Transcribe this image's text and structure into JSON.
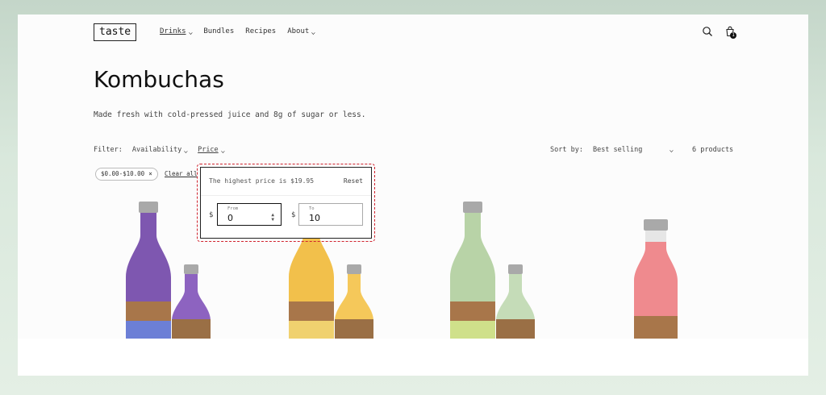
{
  "header": {
    "logo": "taste",
    "nav": [
      {
        "label": "Drinks",
        "has_chevron": true,
        "active": true
      },
      {
        "label": "Bundles",
        "has_chevron": false,
        "active": false
      },
      {
        "label": "Recipes",
        "has_chevron": false,
        "active": false
      },
      {
        "label": "About",
        "has_chevron": true,
        "active": false
      }
    ],
    "icons": [
      "search-icon",
      "cart-icon"
    ],
    "cart_count": "1"
  },
  "collection": {
    "title": "Kombuchas",
    "description": "Made fresh with cold-pressed juice and 8g of sugar or less."
  },
  "filters": {
    "label": "Filter:",
    "availability": "Availability",
    "price": "Price",
    "sort_label": "Sort by:",
    "sort_value": "Best selling",
    "product_count": "6 products",
    "active_chip": "$0.00-$10.00",
    "chip_remove": "×",
    "clear_all": "Clear all"
  },
  "price_popup": {
    "note": "The highest price is $19.95",
    "reset": "Reset",
    "currency": "$",
    "from_label": "From",
    "from_value": "0",
    "to_label": "To",
    "to_value": "10"
  },
  "products": [
    {
      "color": "#7e57b0",
      "name": "purple-kombucha"
    },
    {
      "color": "#f2c04b",
      "name": "yellow-kombucha"
    },
    {
      "color": "#b8d3a7",
      "name": "green-kombucha"
    },
    {
      "color": "#ef8a8e",
      "name": "pink-kombucha"
    }
  ],
  "colors": {
    "accent_outline": "#d0222d",
    "text": "#2a2a2a"
  }
}
